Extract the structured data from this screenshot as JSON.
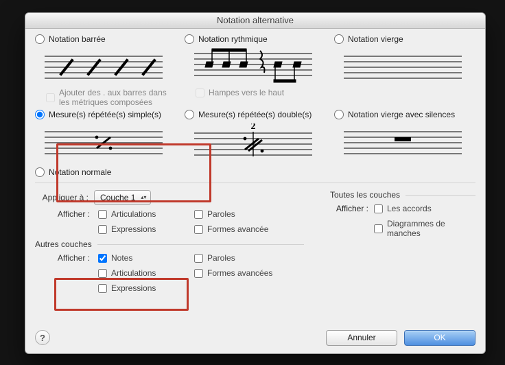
{
  "window": {
    "title": "Notation alternative"
  },
  "options": {
    "slash": {
      "label": "Notation barrée",
      "sub": "Ajouter des . aux barres dans les métriques composées"
    },
    "rhythm": {
      "label": "Notation rythmique",
      "sub": "Hampes vers le haut"
    },
    "blank": {
      "label": "Notation vierge"
    },
    "rep1": {
      "label": "Mesure(s) répétée(s) simple(s)"
    },
    "rep2": {
      "label": "Mesure(s) répétée(s) double(s)",
      "badge": "2"
    },
    "blankR": {
      "label": "Notation vierge avec silences"
    },
    "normal": {
      "label": "Notation normale"
    }
  },
  "apply": {
    "label": "Appliquer à :",
    "layer_selected": "Couche 1",
    "show_label": "Afficher :",
    "checks": {
      "articulations": "Articulations",
      "paroles": "Paroles",
      "expressions": "Expressions",
      "formes": "Formes avancée"
    }
  },
  "all_layers": {
    "title": "Toutes les couches",
    "show_label": "Afficher :",
    "chords": "Les accords",
    "frets": "Diagrammes de manches"
  },
  "other_layers": {
    "title": "Autres couches",
    "show_label": "Afficher :",
    "notes": "Notes",
    "paroles": "Paroles",
    "articulations": "Articulations",
    "formes": "Formes avancées",
    "expressions": "Expressions"
  },
  "footer": {
    "cancel": "Annuler",
    "ok": "OK"
  }
}
